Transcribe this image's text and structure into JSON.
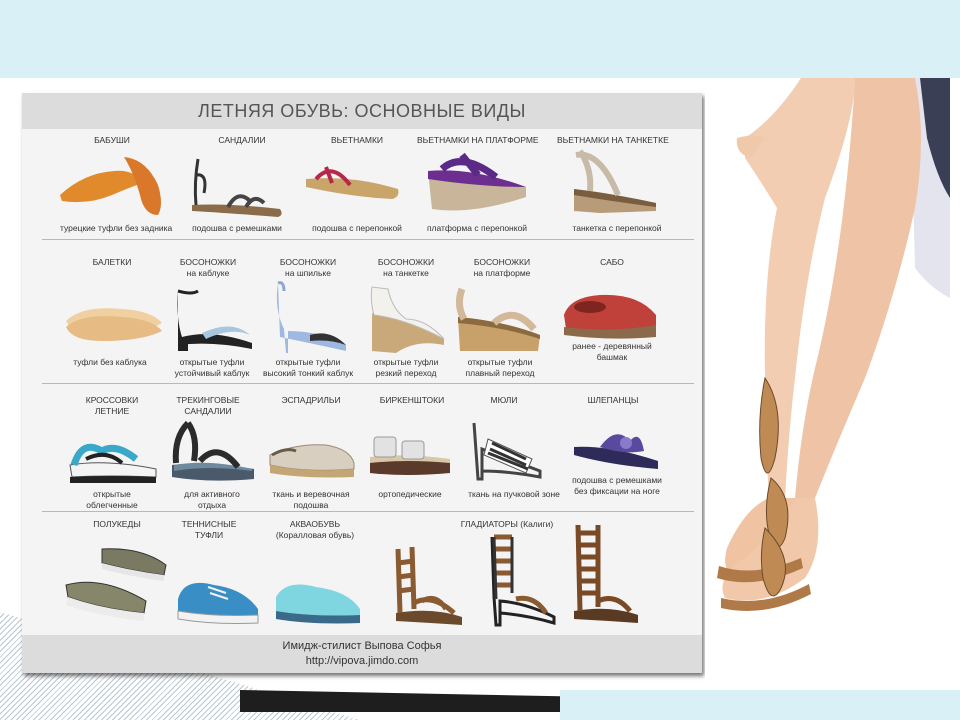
{
  "poster": {
    "title": "ЛЕТНЯЯ ОБУВЬ: ОСНОВНЫЕ ВИДЫ",
    "footer_author": "Имидж-стилист Выпова Софья",
    "footer_url": "http://vipova.jimdo.com"
  },
  "rows": [
    {
      "items": [
        {
          "name": "БАБУШИ",
          "caption": "турецкие туфли без задника"
        },
        {
          "name": "САНДАЛИИ",
          "caption": "подошва с ремешками"
        },
        {
          "name": "ВЬЕТНАМКИ",
          "caption": "подошва с перепонкой"
        },
        {
          "name": "ВЬЕТНАМКИ НА ПЛАТФОРМЕ",
          "caption": "платформа с перепонкой"
        },
        {
          "name": "ВЬЕТНАМКИ НА ТАНКЕТКЕ",
          "caption": "танкетка с перепонкой"
        }
      ]
    },
    {
      "items": [
        {
          "name": "БАЛЕТКИ",
          "name2": "",
          "caption": "туфли без каблука",
          "caption2": ""
        },
        {
          "name": "БОСОНОЖКИ",
          "name2": "на каблуке",
          "caption": "открытые туфли",
          "caption2": "устойчивый каблук"
        },
        {
          "name": "БОСОНОЖКИ",
          "name2": "на шпильке",
          "caption": "открытые туфли",
          "caption2": "высокий тонкий каблук"
        },
        {
          "name": "БОСОНОЖКИ",
          "name2": "на танкетке",
          "caption": "открытые туфли",
          "caption2": "резкий переход"
        },
        {
          "name": "БОСОНОЖКИ",
          "name2": "на платформе",
          "caption": "открытые туфли",
          "caption2": "плавный переход"
        },
        {
          "name": "САБО",
          "name2": "",
          "caption": "ранее - деревянный",
          "caption2": "башмак"
        }
      ]
    },
    {
      "items": [
        {
          "name": "КРОССОВКИ",
          "name2": "ЛЕТНИЕ",
          "caption": "открытые",
          "caption2": "облегченные"
        },
        {
          "name": "ТРЕКИНГОВЫЕ",
          "name2": "САНДАЛИИ",
          "caption": "для активного",
          "caption2": "отдыха"
        },
        {
          "name": "ЭСПАДРИЛЬИ",
          "name2": "",
          "caption": "ткань и веревочная",
          "caption2": "подошва"
        },
        {
          "name": "БИРКЕНШТОКИ",
          "name2": "",
          "caption": "ортопедические",
          "caption2": ""
        },
        {
          "name": "МЮЛИ",
          "name2": "",
          "caption": "ткань на пучковой зоне",
          "caption2": ""
        },
        {
          "name": "ШЛЕПАНЦЫ",
          "name2": "",
          "caption": "подошва с ремешками",
          "caption2": "без фиксации на ноге"
        }
      ]
    },
    {
      "items": [
        {
          "name": "ПОЛУКЕДЫ",
          "name2": ""
        },
        {
          "name": "ТЕННИСНЫЕ",
          "name2": "ТУФЛИ"
        },
        {
          "name": "АКВАОБУВЬ",
          "name2": "(Коралловая обувь)"
        },
        {
          "name": "ГЛАДИАТОРЫ (Калиги)",
          "name2": ""
        }
      ]
    }
  ],
  "colors": {
    "top_band": "#d9f1f6",
    "poster_bg": "#f4f4f4",
    "title_band": "#dcdcdc"
  }
}
